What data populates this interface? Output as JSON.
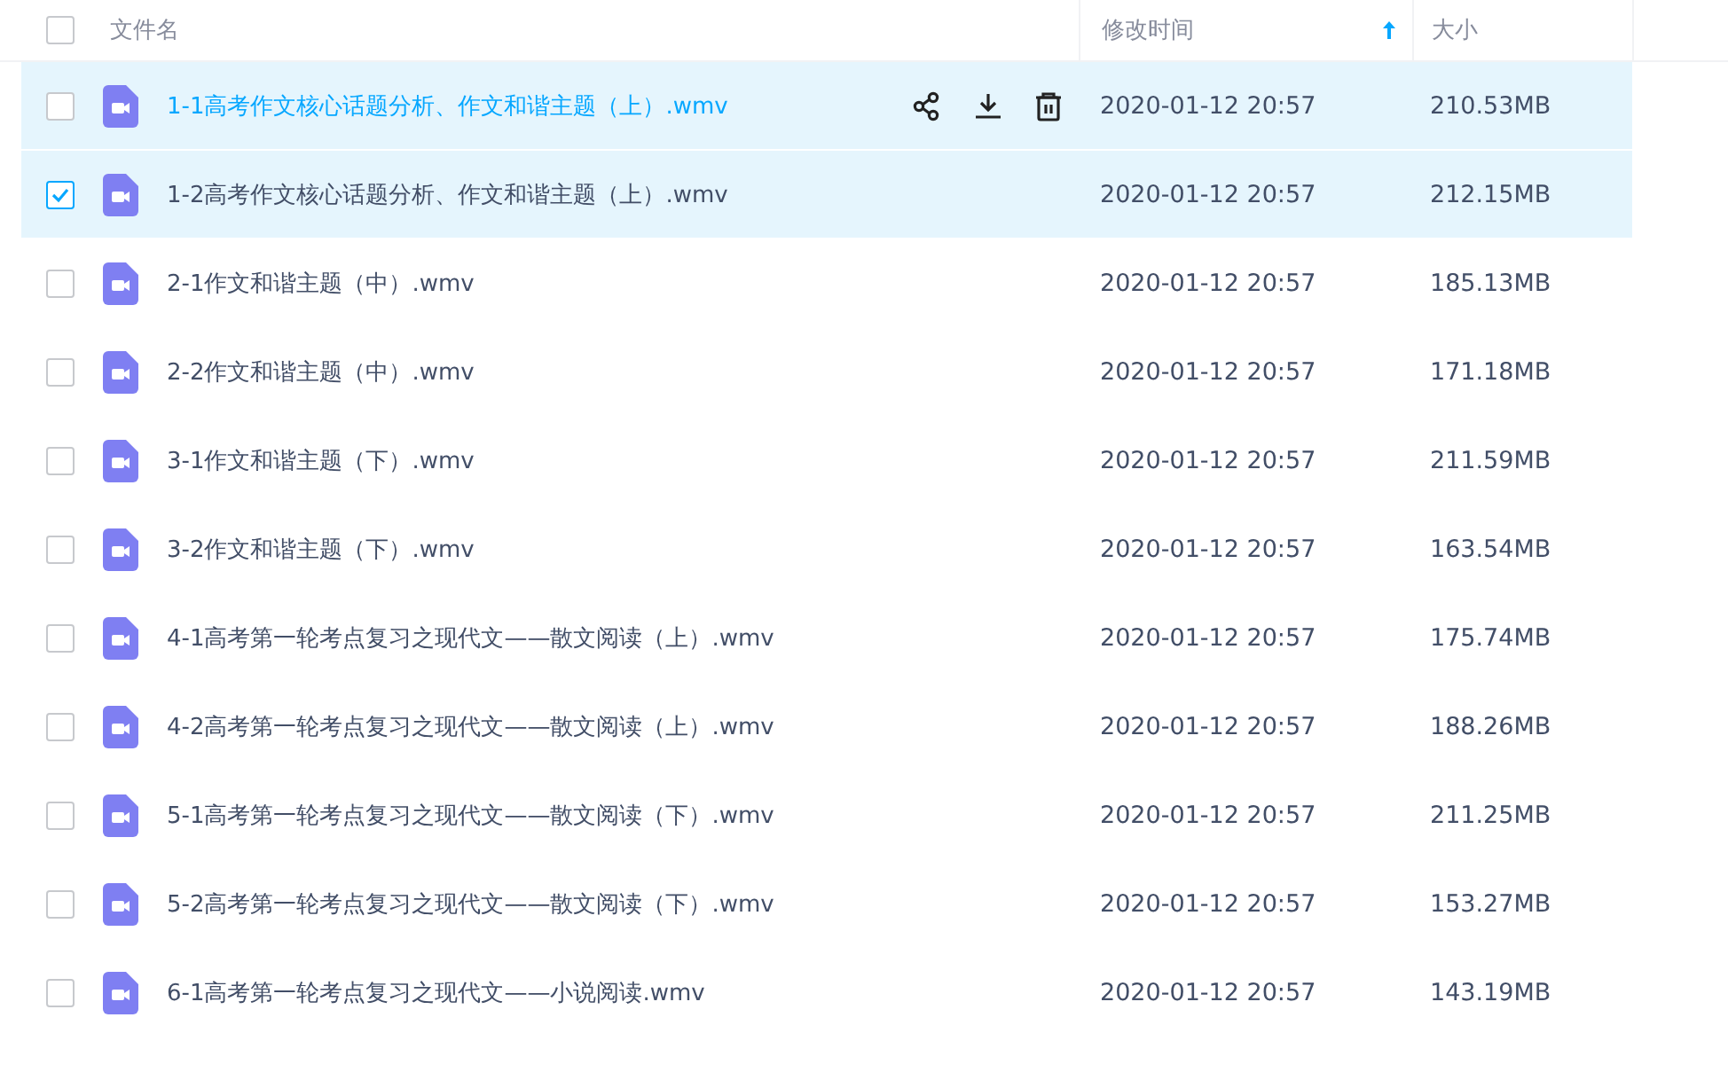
{
  "header": {
    "select_all": {
      "checked": false
    },
    "columns": [
      {
        "label": "文件名",
        "sorted": false
      },
      {
        "label": "修改时间",
        "sorted": true
      },
      {
        "label": "大小",
        "sorted": false
      }
    ]
  },
  "rows": [
    {
      "name": "1-1高考作文核心话题分析、作文和谐主题（上）.wmv",
      "modified": "2020-01-12 20:57",
      "size": "210.53MB",
      "checked": false,
      "hovered": true
    },
    {
      "name": "1-2高考作文核心话题分析、作文和谐主题（上）.wmv",
      "modified": "2020-01-12 20:57",
      "size": "212.15MB",
      "checked": true,
      "hovered": false
    },
    {
      "name": "2-1作文和谐主题（中）.wmv",
      "modified": "2020-01-12 20:57",
      "size": "185.13MB",
      "checked": false,
      "hovered": false
    },
    {
      "name": "2-2作文和谐主题（中）.wmv",
      "modified": "2020-01-12 20:57",
      "size": "171.18MB",
      "checked": false,
      "hovered": false
    },
    {
      "name": "3-1作文和谐主题（下）.wmv",
      "modified": "2020-01-12 20:57",
      "size": "211.59MB",
      "checked": false,
      "hovered": false
    },
    {
      "name": "3-2作文和谐主题（下）.wmv",
      "modified": "2020-01-12 20:57",
      "size": "163.54MB",
      "checked": false,
      "hovered": false
    },
    {
      "name": "4-1高考第一轮考点复习之现代文——散文阅读（上）.wmv",
      "modified": "2020-01-12 20:57",
      "size": "175.74MB",
      "checked": false,
      "hovered": false
    },
    {
      "name": "4-2高考第一轮考点复习之现代文——散文阅读（上）.wmv",
      "modified": "2020-01-12 20:57",
      "size": "188.26MB",
      "checked": false,
      "hovered": false
    },
    {
      "name": "5-1高考第一轮考点复习之现代文——散文阅读（下）.wmv",
      "modified": "2020-01-12 20:57",
      "size": "211.25MB",
      "checked": false,
      "hovered": false
    },
    {
      "name": "5-2高考第一轮考点复习之现代文——散文阅读（下）.wmv",
      "modified": "2020-01-12 20:57",
      "size": "153.27MB",
      "checked": false,
      "hovered": false
    },
    {
      "name": "6-1高考第一轮考点复习之现代文——小说阅读.wmv",
      "modified": "2020-01-12 20:57",
      "size": "143.19MB",
      "checked": false,
      "hovered": false
    }
  ]
}
